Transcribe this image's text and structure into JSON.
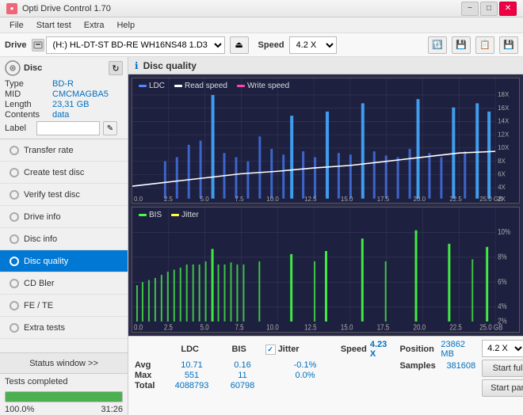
{
  "titleBar": {
    "title": "Opti Drive Control 1.70",
    "minBtn": "−",
    "maxBtn": "□",
    "closeBtn": "✕"
  },
  "menuBar": {
    "items": [
      "File",
      "Start test",
      "Extra",
      "Help"
    ]
  },
  "toolbar": {
    "driveLabel": "Drive",
    "driveName": "(H:) HL-DT-ST BD-RE  WH16NS48 1.D3",
    "speedLabel": "Speed",
    "speedValue": "4.2 X"
  },
  "disc": {
    "header": "Disc",
    "typeLabel": "Type",
    "typeValue": "BD-R",
    "midLabel": "MID",
    "midValue": "CMCMAGBA5",
    "lengthLabel": "Length",
    "lengthValue": "23,31 GB",
    "contentsLabel": "Contents",
    "contentsValue": "data",
    "labelLabel": "Label",
    "labelValue": ""
  },
  "nav": {
    "items": [
      {
        "id": "transfer-rate",
        "label": "Transfer rate",
        "active": false
      },
      {
        "id": "create-test-disc",
        "label": "Create test disc",
        "active": false
      },
      {
        "id": "verify-test-disc",
        "label": "Verify test disc",
        "active": false
      },
      {
        "id": "drive-info",
        "label": "Drive info",
        "active": false
      },
      {
        "id": "disc-info",
        "label": "Disc info",
        "active": false
      },
      {
        "id": "disc-quality",
        "label": "Disc quality",
        "active": true
      },
      {
        "id": "cd-bler",
        "label": "CD Bler",
        "active": false
      },
      {
        "id": "fe-te",
        "label": "FE / TE",
        "active": false
      },
      {
        "id": "extra-tests",
        "label": "Extra tests",
        "active": false
      }
    ]
  },
  "status": {
    "windowLabel": "Status window >>",
    "statusText": "Tests completed",
    "progressPct": 100,
    "progressLabel": "100.0%",
    "timeLabel": "31:26"
  },
  "chartArea": {
    "title": "Disc quality",
    "chart1": {
      "legends": [
        {
          "label": "LDC",
          "color": "#4488ff"
        },
        {
          "label": "Read speed",
          "color": "#ffffff"
        },
        {
          "label": "Write speed",
          "color": "#ff44aa"
        }
      ],
      "yLabels": [
        "18X",
        "16X",
        "14X",
        "12X",
        "10X",
        "8X",
        "6X",
        "4X",
        "2X"
      ],
      "xLabels": [
        "0.0",
        "2.5",
        "5.0",
        "7.5",
        "10.0",
        "12.5",
        "15.0",
        "17.5",
        "20.0",
        "22.5",
        "25.0 GB"
      ]
    },
    "chart2": {
      "legends": [
        {
          "label": "BIS",
          "color": "#44ff44"
        },
        {
          "label": "Jitter",
          "color": "#ffff44"
        }
      ],
      "yLabels": [
        "10%",
        "8%",
        "6%",
        "4%",
        "2%"
      ],
      "xLabels": [
        "0.0",
        "2.5",
        "5.0",
        "7.5",
        "10.0",
        "12.5",
        "15.0",
        "17.5",
        "20.0",
        "22.5",
        "25.0 GB"
      ]
    }
  },
  "stats": {
    "headers": {
      "ldc": "LDC",
      "bis": "BIS",
      "jitter": "Jitter",
      "speed": "Speed",
      "speedVal": "4.23 X"
    },
    "rows": [
      {
        "label": "Avg",
        "ldc": "10.71",
        "bis": "0.16",
        "jitter": "-0.1%"
      },
      {
        "label": "Max",
        "ldc": "551",
        "bis": "11",
        "jitter": "0.0%"
      },
      {
        "label": "Total",
        "ldc": "4088793",
        "bis": "60798",
        "jitter": ""
      }
    ],
    "right": {
      "positionLabel": "Position",
      "positionVal": "23862 MB",
      "samplesLabel": "Samples",
      "samplesVal": "381608"
    },
    "speedDropdown": "4.2 X",
    "startFullBtn": "Start full",
    "startPartBtn": "Start part"
  }
}
